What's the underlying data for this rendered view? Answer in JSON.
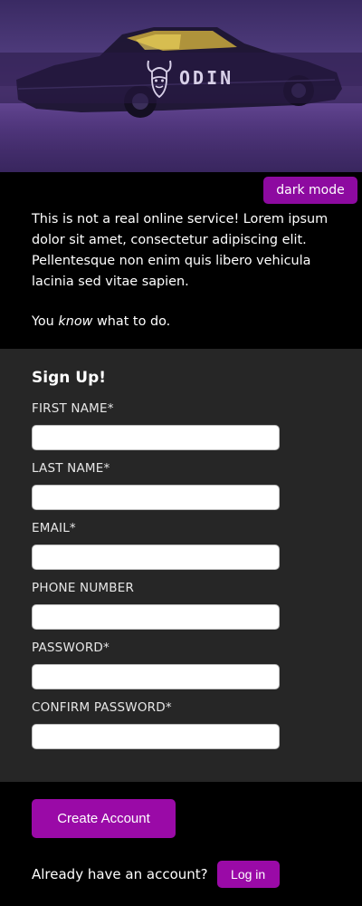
{
  "hero": {
    "logo_text": "ODIN",
    "logo_icon": "viking-head-icon",
    "image_subject": "car-icon"
  },
  "toolbar": {
    "mode_label": "dark mode"
  },
  "intro": {
    "paragraph": "This is not a real online service! Lorem ipsum dolor sit amet, consectetur adipiscing elit. Pellentesque non enim quis libero vehicula lacinia sed vitae sapien.",
    "cta_prefix": "You ",
    "cta_emphasis": "know",
    "cta_suffix": " what to do."
  },
  "form": {
    "title": "Sign Up!",
    "fields": [
      {
        "label": "FIRST NAME*",
        "value": ""
      },
      {
        "label": "LAST NAME*",
        "value": ""
      },
      {
        "label": "EMAIL*",
        "value": ""
      },
      {
        "label": "PHONE NUMBER",
        "value": ""
      },
      {
        "label": "PASSWORD*",
        "value": ""
      },
      {
        "label": "CONFIRM PASSWORD*",
        "value": ""
      }
    ]
  },
  "actions": {
    "create_label": "Create Account",
    "login_prompt": "Already have an account?",
    "login_label": "Log in"
  },
  "colors": {
    "accent": "#9a0aa7",
    "panel": "#262626",
    "background": "#000000"
  }
}
